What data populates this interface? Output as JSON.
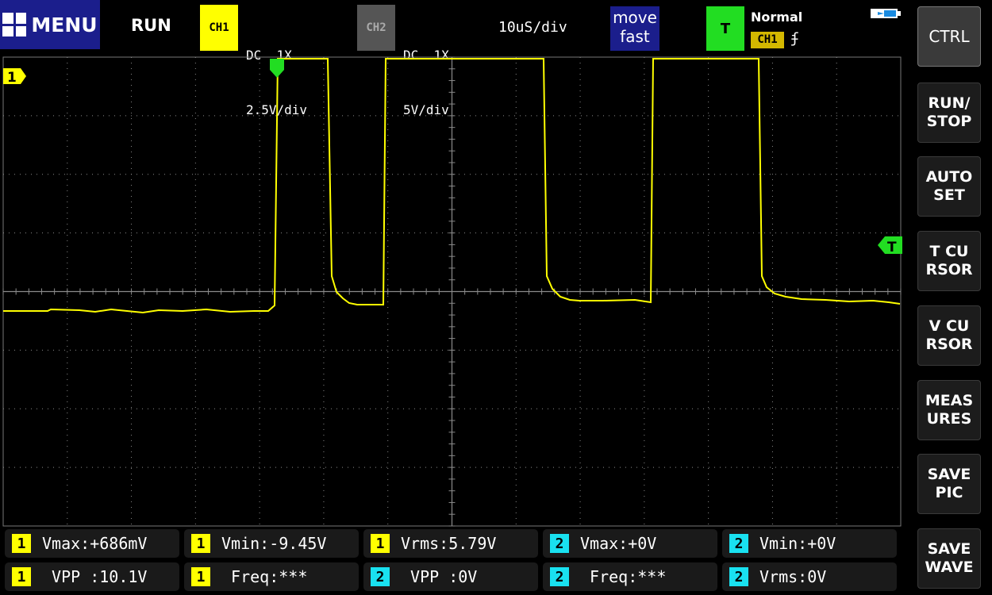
{
  "toolbar": {
    "menu_label": "MENU",
    "run_state": "RUN",
    "ch1": {
      "tag": "CH1",
      "coupling": "DC  1X",
      "scale": "2.5V/div"
    },
    "ch2": {
      "tag": "CH2",
      "coupling": "DC  1X",
      "scale": "5V/div"
    },
    "timebase": "10uS/div",
    "move_label_1": "move",
    "move_label_2": "fast",
    "trigger": {
      "tag": "T",
      "mode": "Normal",
      "source": "CH1",
      "edge": "ʄ"
    }
  },
  "side_buttons": [
    {
      "label": "CTRL"
    },
    {
      "label": "RUN/\nSTOP"
    },
    {
      "label": "AUTO\nSET"
    },
    {
      "label": "T CU\nRSOR"
    },
    {
      "label": "V CU\nRSOR"
    },
    {
      "label": "MEAS\nURES"
    },
    {
      "label": "SAVE\nPIC"
    },
    {
      "label": "SAVE\nWAVE"
    }
  ],
  "markers": {
    "ch1_level": "1",
    "trigger_level": "T"
  },
  "measurements": [
    {
      "channel": "1",
      "text": "Vmax:+686mV"
    },
    {
      "channel": "1",
      "text": "Vmin:-9.45V"
    },
    {
      "channel": "1",
      "text": "Vrms:5.79V"
    },
    {
      "channel": "2",
      "text": "Vmax:+0V"
    },
    {
      "channel": "2",
      "text": "Vmin:+0V"
    },
    {
      "channel": "1",
      "text": " VPP :10.1V"
    },
    {
      "channel": "1",
      "text": " Freq:***"
    },
    {
      "channel": "2",
      "text": " VPP :0V"
    },
    {
      "channel": "2",
      "text": " Freq:***"
    },
    {
      "channel": "2",
      "text": "Vrms:0V"
    }
  ],
  "colors": {
    "ch1": "#ffff00",
    "ch2": "#19e1f0",
    "trigger": "#22dd22",
    "menu": "#1b1e8c"
  }
}
